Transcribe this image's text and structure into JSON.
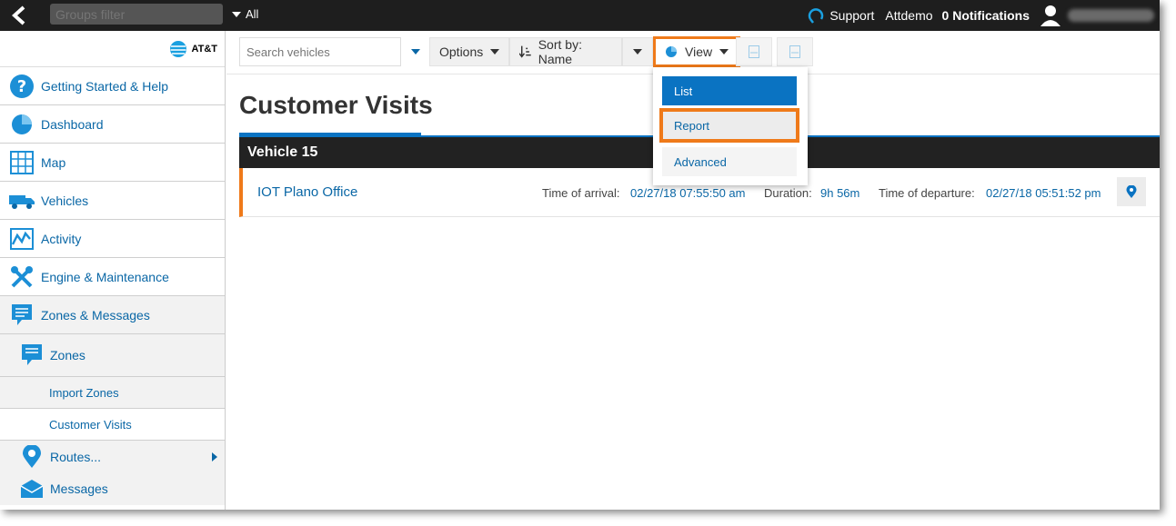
{
  "topbar": {
    "groups_filter_placeholder": "Groups filter",
    "all_label": "All",
    "support_label": "Support",
    "account_label": "Attdemo",
    "notifications_label": "0 Notifications"
  },
  "sidebar": {
    "logo_text": "AT&T",
    "items": [
      {
        "label": "Getting Started & Help",
        "icon": "help-icon"
      },
      {
        "label": "Dashboard",
        "icon": "pie-chart-icon"
      },
      {
        "label": "Map",
        "icon": "map-icon"
      },
      {
        "label": "Vehicles",
        "icon": "truck-icon"
      },
      {
        "label": "Activity",
        "icon": "activity-icon"
      },
      {
        "label": "Engine & Maintenance",
        "icon": "tools-icon"
      },
      {
        "label": "Zones & Messages",
        "icon": "message-icon"
      }
    ],
    "submenu": {
      "zones_label": "Zones",
      "import_zones_label": "Import Zones",
      "customer_visits_label": "Customer Visits",
      "routes_label": "Routes...",
      "messages_label": "Messages"
    }
  },
  "toolbar": {
    "search_placeholder": "Search vehicles",
    "options_label": "Options",
    "sort_label": "Sort by: Name",
    "view_label": "View"
  },
  "view_menu": {
    "list_label": "List",
    "report_label": "Report",
    "advanced_label": "Advanced"
  },
  "page": {
    "title": "Customer Visits",
    "group_header": "Vehicle 15",
    "visit": {
      "name": "IOT Plano Office",
      "arrival_label": "Time of arrival:",
      "arrival_value": "02/27/18 07:55:50 am",
      "duration_label": "Duration:",
      "duration_value": "9h 56m",
      "departure_label": "Time of departure:",
      "departure_value": "02/27/18 05:51:52 pm"
    }
  },
  "colors": {
    "accent_blue": "#0a73c2",
    "link_blue": "#0a67a6",
    "highlight_orange": "#ef7a1a",
    "topbar": "#1e1e1e"
  }
}
